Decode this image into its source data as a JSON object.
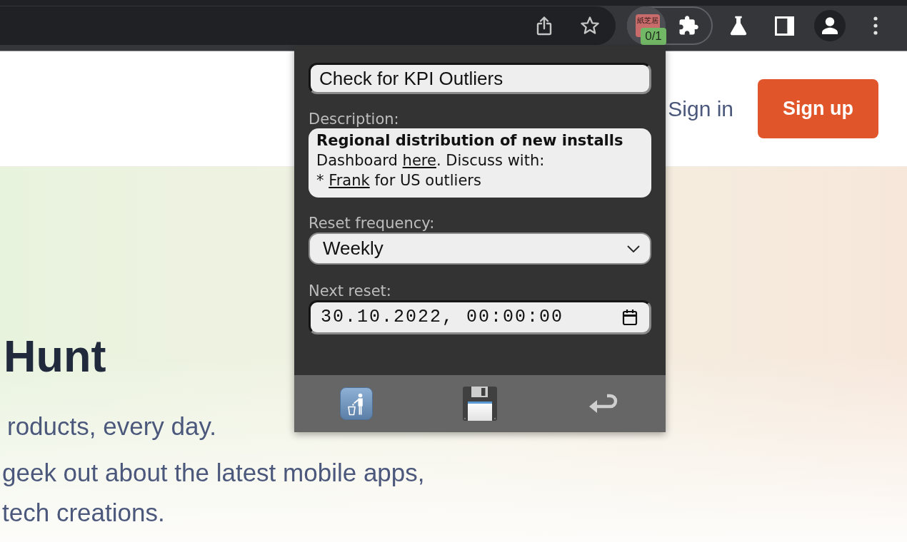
{
  "toolbar": {
    "extension": {
      "logo_text": "紙芝居",
      "badge": "0/1"
    }
  },
  "page": {
    "nav": {
      "sign_in": "Sign in",
      "sign_up": "Sign up"
    },
    "hero": {
      "title": "Hunt",
      "tagline": "roducts, every day.",
      "paragraph_lines": [
        "geek out about the latest mobile apps,",
        "tech creations."
      ]
    }
  },
  "popup": {
    "title_field": {
      "value": "Check for KPI Outliers"
    },
    "description": {
      "label": "Description:",
      "lines": [
        {
          "kind": "heading",
          "parts": [
            {
              "kind": "text",
              "text": "Regional distribution of new installs"
            }
          ]
        },
        {
          "kind": "text",
          "parts": [
            {
              "kind": "text",
              "text": "Dashboard "
            },
            {
              "kind": "link",
              "text": "here"
            },
            {
              "kind": "text",
              "text": ". Discuss with:"
            }
          ]
        },
        {
          "kind": "text",
          "parts": [
            {
              "kind": "text",
              "text": "* "
            },
            {
              "kind": "link",
              "text": "Frank"
            },
            {
              "kind": "text",
              "text": " for US outliers"
            }
          ]
        }
      ]
    },
    "reset_frequency": {
      "label": "Reset frequency:",
      "value": "Weekly"
    },
    "next_reset": {
      "label": "Next reset:",
      "value": "30.10.2022, 00:00:00"
    },
    "actions": [
      {
        "kind": "delete"
      },
      {
        "kind": "save"
      },
      {
        "kind": "back"
      }
    ]
  }
}
